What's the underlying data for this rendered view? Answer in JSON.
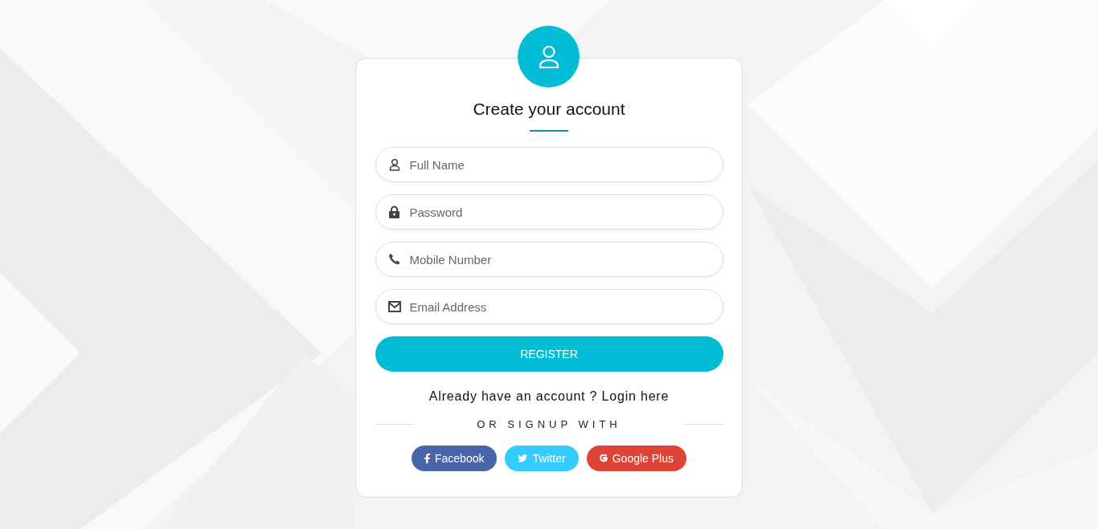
{
  "form": {
    "title": "Create your account",
    "fields": [
      {
        "placeholder": "Full Name"
      },
      {
        "placeholder": "Password"
      },
      {
        "placeholder": "Mobile Number"
      },
      {
        "placeholder": "Email Address"
      }
    ],
    "submit_button": "REGISTER",
    "login_prompt": {
      "text": "Already have an account ?",
      "link": "Login here"
    },
    "divider_label": "OR SIGNUP WITH",
    "social_buttons": [
      {
        "label": "Facebook",
        "color": "#4765a8"
      },
      {
        "label": "Twitter",
        "color": "#33ccff"
      },
      {
        "label": "Google Plus",
        "color": "#dd4337"
      }
    ]
  }
}
